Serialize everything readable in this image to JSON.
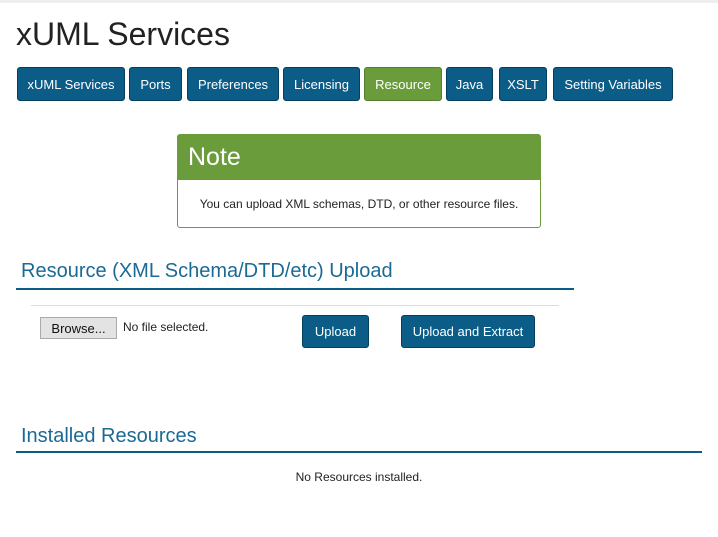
{
  "page_title": "xUML Services",
  "tabs": [
    {
      "label": "xUML Services"
    },
    {
      "label": "Ports"
    },
    {
      "label": "Preferences"
    },
    {
      "label": "Licensing"
    },
    {
      "label": "Resource",
      "active": true
    },
    {
      "label": "Java"
    },
    {
      "label": "XSLT"
    },
    {
      "label": "Setting Variables"
    }
  ],
  "colors": {
    "primary": "#0b5d88",
    "accent": "#6a9c3c"
  },
  "note": {
    "title": "Note",
    "text": "You can upload XML schemas, DTD, or other resource files."
  },
  "upload": {
    "heading": "Resource (XML Schema/DTD/etc) Upload",
    "browse_label": "Browse...",
    "file_status": "No file selected.",
    "upload_label": "Upload",
    "upload_extract_label": "Upload and Extract"
  },
  "installed": {
    "heading": "Installed Resources",
    "empty_text": "No Resources installed."
  }
}
